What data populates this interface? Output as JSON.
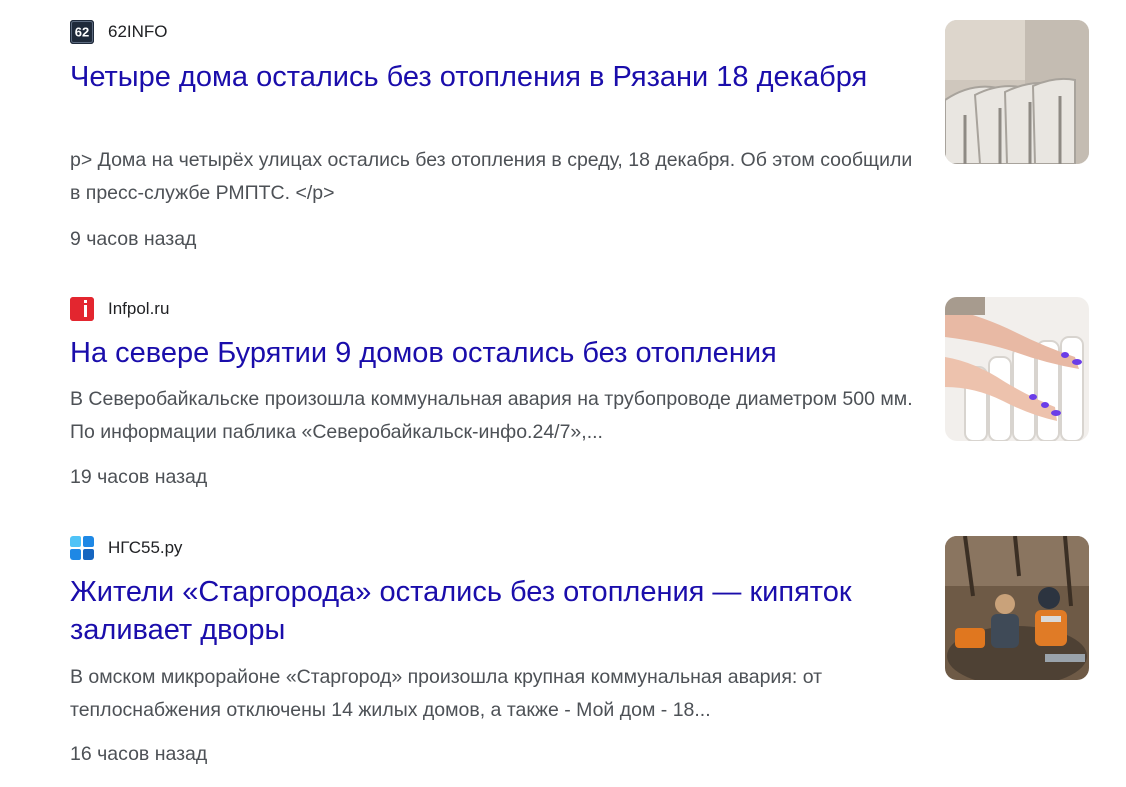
{
  "articles": [
    {
      "source": "62INFO",
      "logo_icon": "62info-logo-icon",
      "logo_text": "62",
      "headline": "Четыре дома остались без отопления в Рязани 18 декабря",
      "snippet": "p> Дома на четырёх улицах остались без отопления в среду, 18 декабря. Об этом сообщили в пресс-службе РМПТС. </p>",
      "time": "9 часов назад",
      "thumbnail_icon": "radiator-image"
    },
    {
      "source": "Infpol.ru",
      "logo_icon": "infpol-logo-icon",
      "headline": "На севере Бурятии 9 домов остались без отопления",
      "snippet": "В Северобайкальске произошла коммунальная авария на трубопроводе диаметром 500 мм. По информации паблика «Северобайкальск-инфо.24/7»,...",
      "time": "19 часов назад",
      "thumbnail_icon": "hands-on-radiator-image"
    },
    {
      "source": "НГС55.ру",
      "logo_icon": "ngs55-logo-icon",
      "headline": "Жители «Старгорода» остались без отопления — кипяток заливает дворы",
      "snippet": "В омском микрорайоне «Старгород» произошла крупная коммунальная авария: от теплоснабжения отключены 14 жилых домов, а также - Мой дом - 18...",
      "time": "16 часов назад",
      "thumbnail_icon": "workers-repair-image"
    }
  ],
  "colors": {
    "headline": "#1a0dab",
    "snippet": "#4d5156",
    "source": "#202124",
    "infpol_brand": "#e3262f",
    "ngs_brand": "#1e88e5"
  }
}
